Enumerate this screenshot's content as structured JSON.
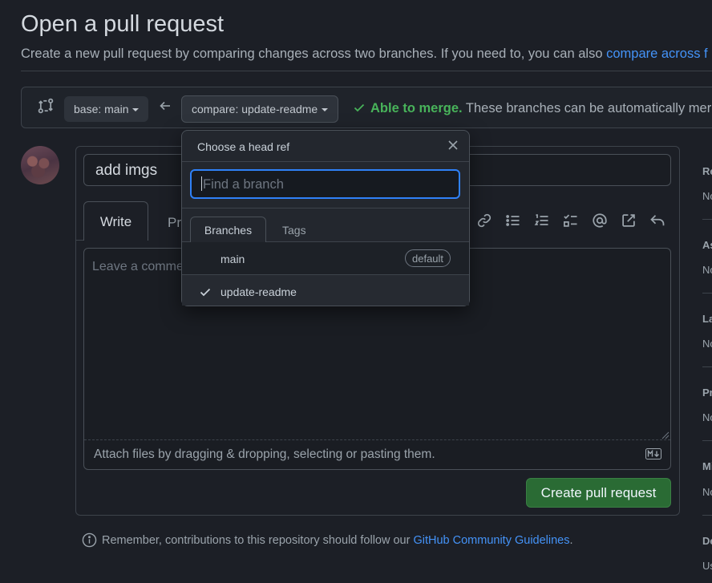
{
  "page": {
    "title": "Open a pull request",
    "subtitle_text": "Create a new pull request by comparing changes across two branches. If you need to, you can also ",
    "subtitle_link": "compare across f"
  },
  "range": {
    "base_label": "base: main",
    "compare_label": "compare: update-readme",
    "merge_status": "Able to merge.",
    "merge_message": " These branches can be automatically merg"
  },
  "form": {
    "title_value": "add imgs",
    "tab_write": "Write",
    "tab_preview": "Pr",
    "body_placeholder": "Leave a comme",
    "attach_hint": "Attach files by dragging & dropping, selecting or pasting them.",
    "submit_label": "Create pull request"
  },
  "note": {
    "text": "Remember, contributions to this repository should follow our ",
    "link": "GitHub Community Guidelines",
    "tail": "."
  },
  "sidebar": {
    "items": [
      {
        "label": "Re",
        "value": "No"
      },
      {
        "label": "As",
        "value": "No"
      },
      {
        "label": "La",
        "value": "No"
      },
      {
        "label": "Pr",
        "value": "No"
      },
      {
        "label": "Mi",
        "value": "No"
      },
      {
        "label": "De",
        "value": "Us"
      }
    ]
  },
  "popover": {
    "title": "Choose a head ref",
    "search_placeholder": "Find a branch",
    "tab_branches": "Branches",
    "tab_tags": "Tags",
    "branches": [
      {
        "name": "main",
        "badge": "default",
        "selected": false
      },
      {
        "name": "update-readme",
        "badge": "",
        "selected": true
      }
    ]
  },
  "colors": {
    "accent_link": "#4493f8",
    "merge_ok": "#48b35a",
    "primary_button": "#2a6b34",
    "focus_ring": "#2f81f7"
  }
}
